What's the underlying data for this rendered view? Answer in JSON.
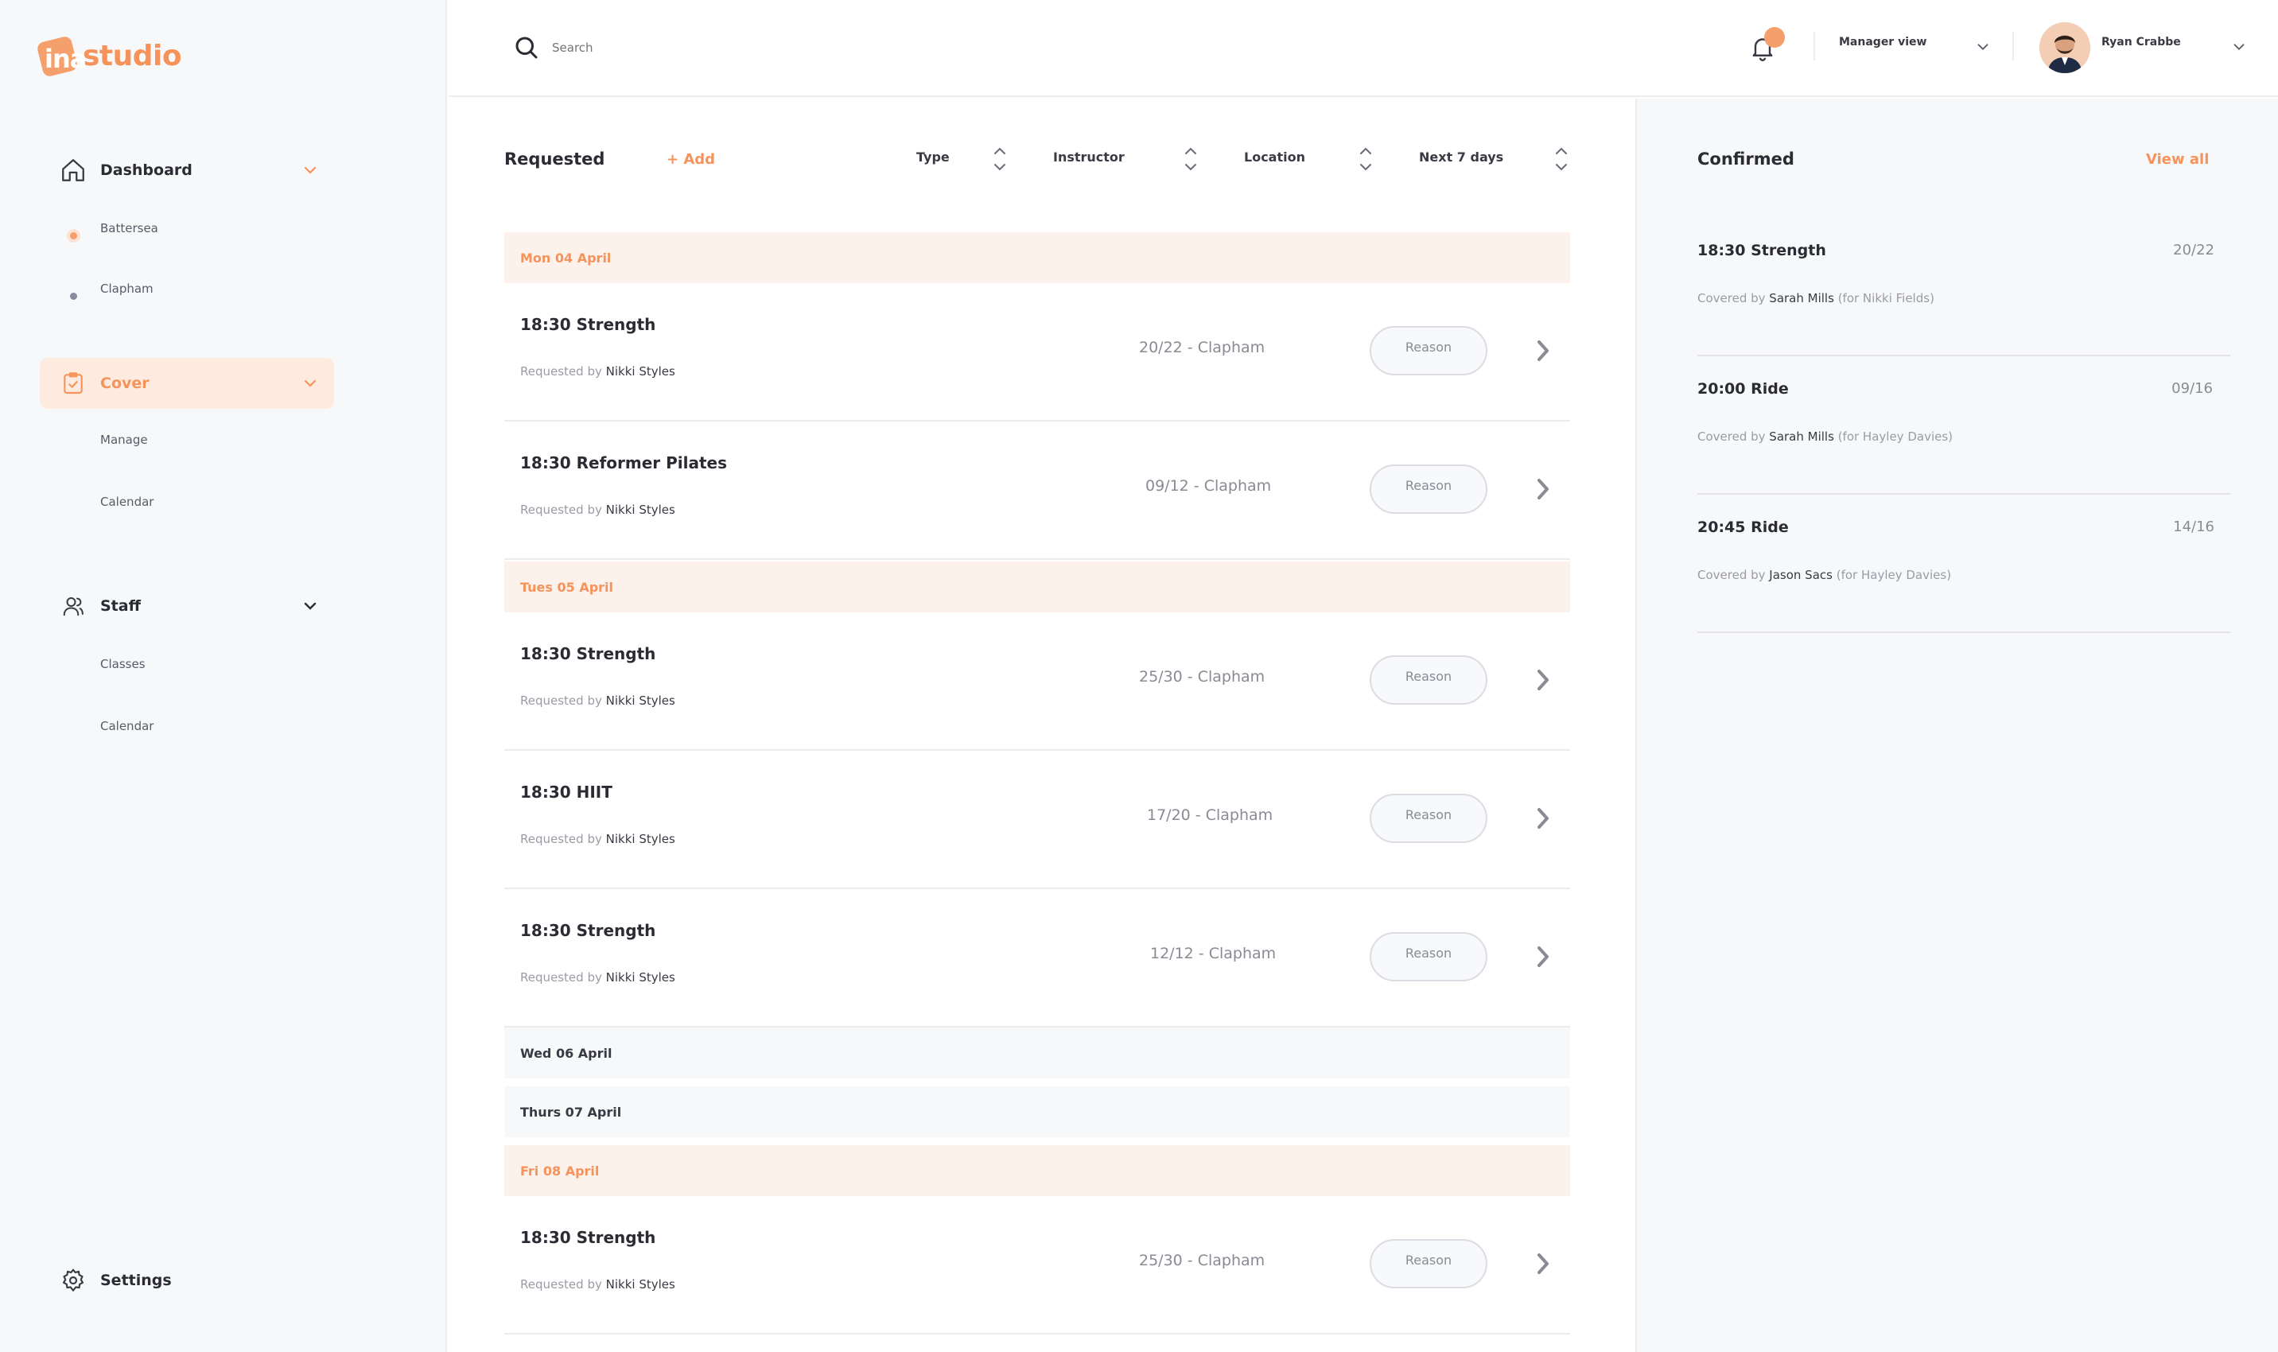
{
  "brand": {
    "mark": "ina",
    "name": "studio",
    "accent": "#f5935a"
  },
  "sidebar": {
    "dashboard": {
      "label": "Dashboard",
      "items": [
        "Battersea",
        "Clapham"
      ]
    },
    "cover": {
      "label": "Cover",
      "items": [
        "Manage",
        "Calendar"
      ]
    },
    "staff": {
      "label": "Staff",
      "items": [
        "Classes",
        "Calendar"
      ]
    },
    "settings": {
      "label": "Settings"
    }
  },
  "topbar": {
    "search": {
      "placeholder": "Search"
    },
    "view": "Manager view",
    "user": "Ryan Crabbe"
  },
  "requested": {
    "title": "Requested",
    "add": "+ Add",
    "filters": [
      "Type",
      "Instructor",
      "Location",
      "Next 7 days"
    ],
    "days": [
      {
        "label": "Mon 04 April"
      },
      {
        "label": "Tues 05 April"
      },
      {
        "label": "Wed 06 April"
      },
      {
        "label": "Thurs 07 April"
      },
      {
        "label": "Fri 08 April"
      }
    ],
    "requested_by_prefix": "Requested by",
    "reason_label": "Reason",
    "rows": [
      {
        "title": "18:30 Strength",
        "by": "Nikki Styles",
        "capacity": "20/22 - Clapham"
      },
      {
        "title": "18:30 Reformer Pilates",
        "by": "Nikki Styles",
        "capacity": "09/12 - Clapham"
      },
      {
        "title": "18:30 Strength",
        "by": "Nikki Styles",
        "capacity": "25/30 - Clapham"
      },
      {
        "title": "18:30 HIIT",
        "by": "Nikki Styles",
        "capacity": "17/20 - Clapham"
      },
      {
        "title": "18:30 Strength",
        "by": "Nikki Styles",
        "capacity": "12/12 - Clapham"
      },
      {
        "title": "18:30 Strength",
        "by": "Nikki Styles",
        "capacity": "25/30 - Clapham"
      }
    ]
  },
  "confirmed": {
    "title": "Confirmed",
    "view_all": "View all",
    "covered_by_prefix": "Covered by",
    "items": [
      {
        "title": "18:30 Strength",
        "count": "20/22",
        "by": "Sarah Mills",
        "note": "(for Nikki Fields)"
      },
      {
        "title": "20:00 Ride",
        "count": "09/16",
        "by": "Sarah Mills",
        "note": "(for Hayley Davies)"
      },
      {
        "title": "20:45 Ride",
        "count": "14/16",
        "by": "Jason Sacs",
        "note": "(for Hayley Davies)"
      }
    ]
  },
  "icons": [
    "home-icon",
    "clipboard-icon",
    "users-icon",
    "gear-icon",
    "search-icon",
    "bell-icon",
    "chevron-down-icon",
    "sort-icon",
    "chevron-right-icon"
  ]
}
